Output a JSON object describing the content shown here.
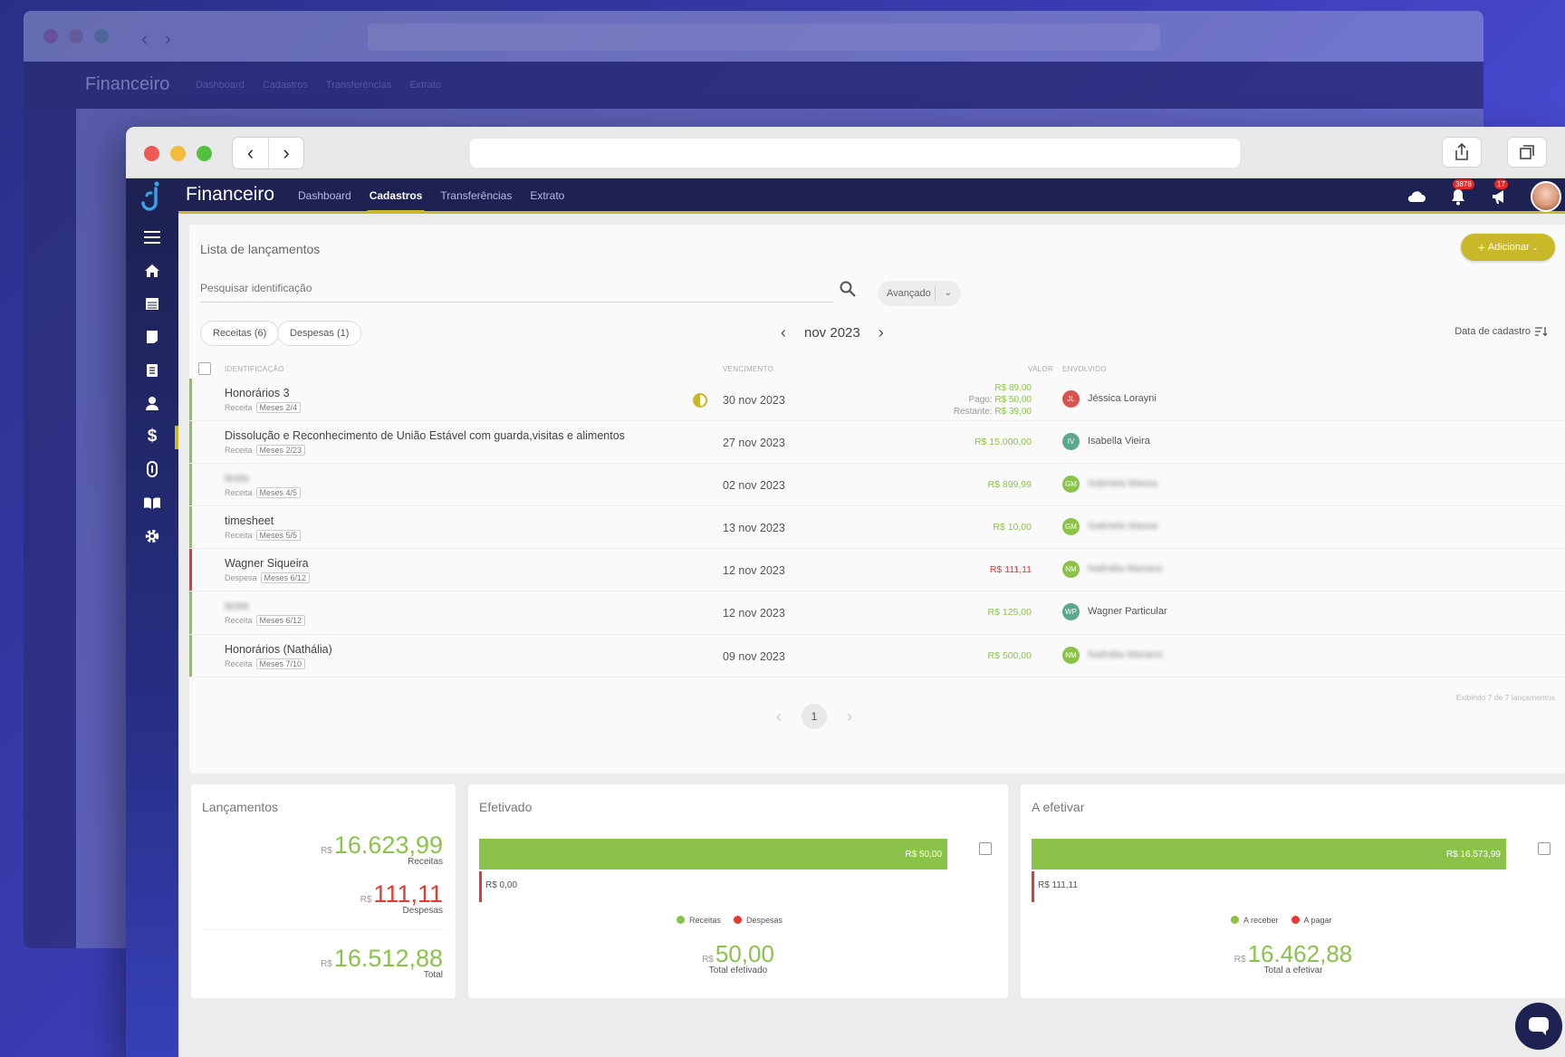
{
  "ghost": {
    "title": "Financeiro",
    "menu": [
      "Dashboard",
      "Cadastros",
      "Transferências",
      "Extrato"
    ]
  },
  "app": {
    "title": "Financeiro",
    "menu": [
      {
        "label": "Dashboard",
        "active": false
      },
      {
        "label": "Cadastros",
        "active": true
      },
      {
        "label": "Transferências",
        "active": false
      },
      {
        "label": "Extrato",
        "active": false
      }
    ],
    "notifications_badge": "3878",
    "alerts_badge": "17"
  },
  "sidebar": {
    "items": [
      "menu-icon",
      "home-icon",
      "calendar-icon",
      "document-icon",
      "files-icon",
      "user-icon",
      "dollar-icon",
      "attachment-icon",
      "book-icon",
      "gear-icon"
    ],
    "active_index": 6
  },
  "list": {
    "title": "Lista de lançamentos",
    "add_label": "Adicionar",
    "search_placeholder": "Pesquisar identificação",
    "advanced_label": "Avançado",
    "filter_receitas": "Receitas (6)",
    "filter_despesas": "Despesas (1)",
    "month": "nov 2023",
    "sort_label": "Data de cadastro",
    "columns": {
      "identificacao": "IDENTIFICAÇÃO",
      "vencimento": "VENCIMENTO",
      "valor": "VALOR",
      "envolvido": "ENVOLVIDO"
    },
    "rows": [
      {
        "name": "Honorários 3",
        "type": "Receita",
        "tag": "Meses 2/4",
        "date": "30 nov 2023",
        "value": "R$ 89,00",
        "paid": "R$ 50,00",
        "remaining": "R$ 39,00",
        "paid_label": "Pago:",
        "remaining_label": "Restante:",
        "initials": "JL",
        "person": "Jéssica Lorayni",
        "avatar_color": "#d9534f",
        "stripe": "#8bc34a"
      },
      {
        "name": "Dissolução e Reconhecimento de União Estável com guarda,visitas e alimentos",
        "type": "Receita",
        "tag": "Meses 2/23",
        "date": "27 nov 2023",
        "value": "R$ 15.000,00",
        "initials": "IV",
        "person": "Isabella Vieira",
        "avatar_color": "#5aa98a",
        "stripe": "#8bc34a"
      },
      {
        "name": "teste",
        "type": "Receita",
        "tag": "Meses 4/5",
        "date": "02 nov 2023",
        "value": "R$ 899,99",
        "initials": "GM",
        "person": "Gabriela Massa",
        "avatar_color": "#8bc34a",
        "stripe": "#8bc34a"
      },
      {
        "name": "timesheet",
        "type": "Receita",
        "tag": "Meses 5/5",
        "date": "13 nov 2023",
        "value": "R$ 10,00",
        "initials": "GM",
        "person": "Gabriela Massa",
        "avatar_color": "#8bc34a",
        "stripe": "#8bc34a"
      },
      {
        "name": "Wagner Siqueira",
        "type": "Despesa",
        "tag": "Meses 6/12",
        "date": "12 nov 2023",
        "value": "R$ 111,11",
        "initials": "NM",
        "person": "Nathália Mariano",
        "avatar_color": "#8bc34a",
        "stripe": "#e53935"
      },
      {
        "name": "teste",
        "type": "Receita",
        "tag": "Meses 6/12",
        "date": "12 nov 2023",
        "value": "R$ 125,00",
        "initials": "WP",
        "person": "Wagner Particular",
        "avatar_color": "#5aa98a",
        "stripe": "#8bc34a"
      },
      {
        "name": "Honorários (Nathália)",
        "type": "Receita",
        "tag": "Meses 7/10",
        "date": "09 nov 2023",
        "value": "R$ 500,00",
        "initials": "NM",
        "person": "Nathália Mariano",
        "avatar_color": "#8bc34a",
        "stripe": "#8bc34a"
      }
    ],
    "showing": "Exibindo 7 de 7 lançamentos",
    "page": "1"
  },
  "cards": {
    "lancamentos": {
      "title": "Lançamentos",
      "currency": "R$",
      "receitas_value": "16.623,99",
      "receitas_label": "Receitas",
      "despesas_value": "111,11",
      "despesas_label": "Despesas",
      "total_value": "16.512,88",
      "total_label": "Total"
    },
    "efetivado": {
      "title": "Efetivado",
      "bar_green_label": "R$ 50,00",
      "bar_red_label": "R$ 0,00",
      "legend_a": "Receitas",
      "legend_b": "Despesas",
      "currency": "R$",
      "total_value": "50,00",
      "total_label": "Total efetivado"
    },
    "a_efetivar": {
      "title": "A efetivar",
      "bar_green_label": "R$ 16.573,99",
      "bar_red_label": "R$ 111,11",
      "legend_a": "A receber",
      "legend_b": "A pagar",
      "currency": "R$",
      "total_value": "16.462,88",
      "total_label": "Total a efetivar"
    }
  },
  "colors": {
    "accent": "#c9b82a",
    "navy": "#1d2253",
    "green": "#8bc34a",
    "red": "#e53935"
  }
}
